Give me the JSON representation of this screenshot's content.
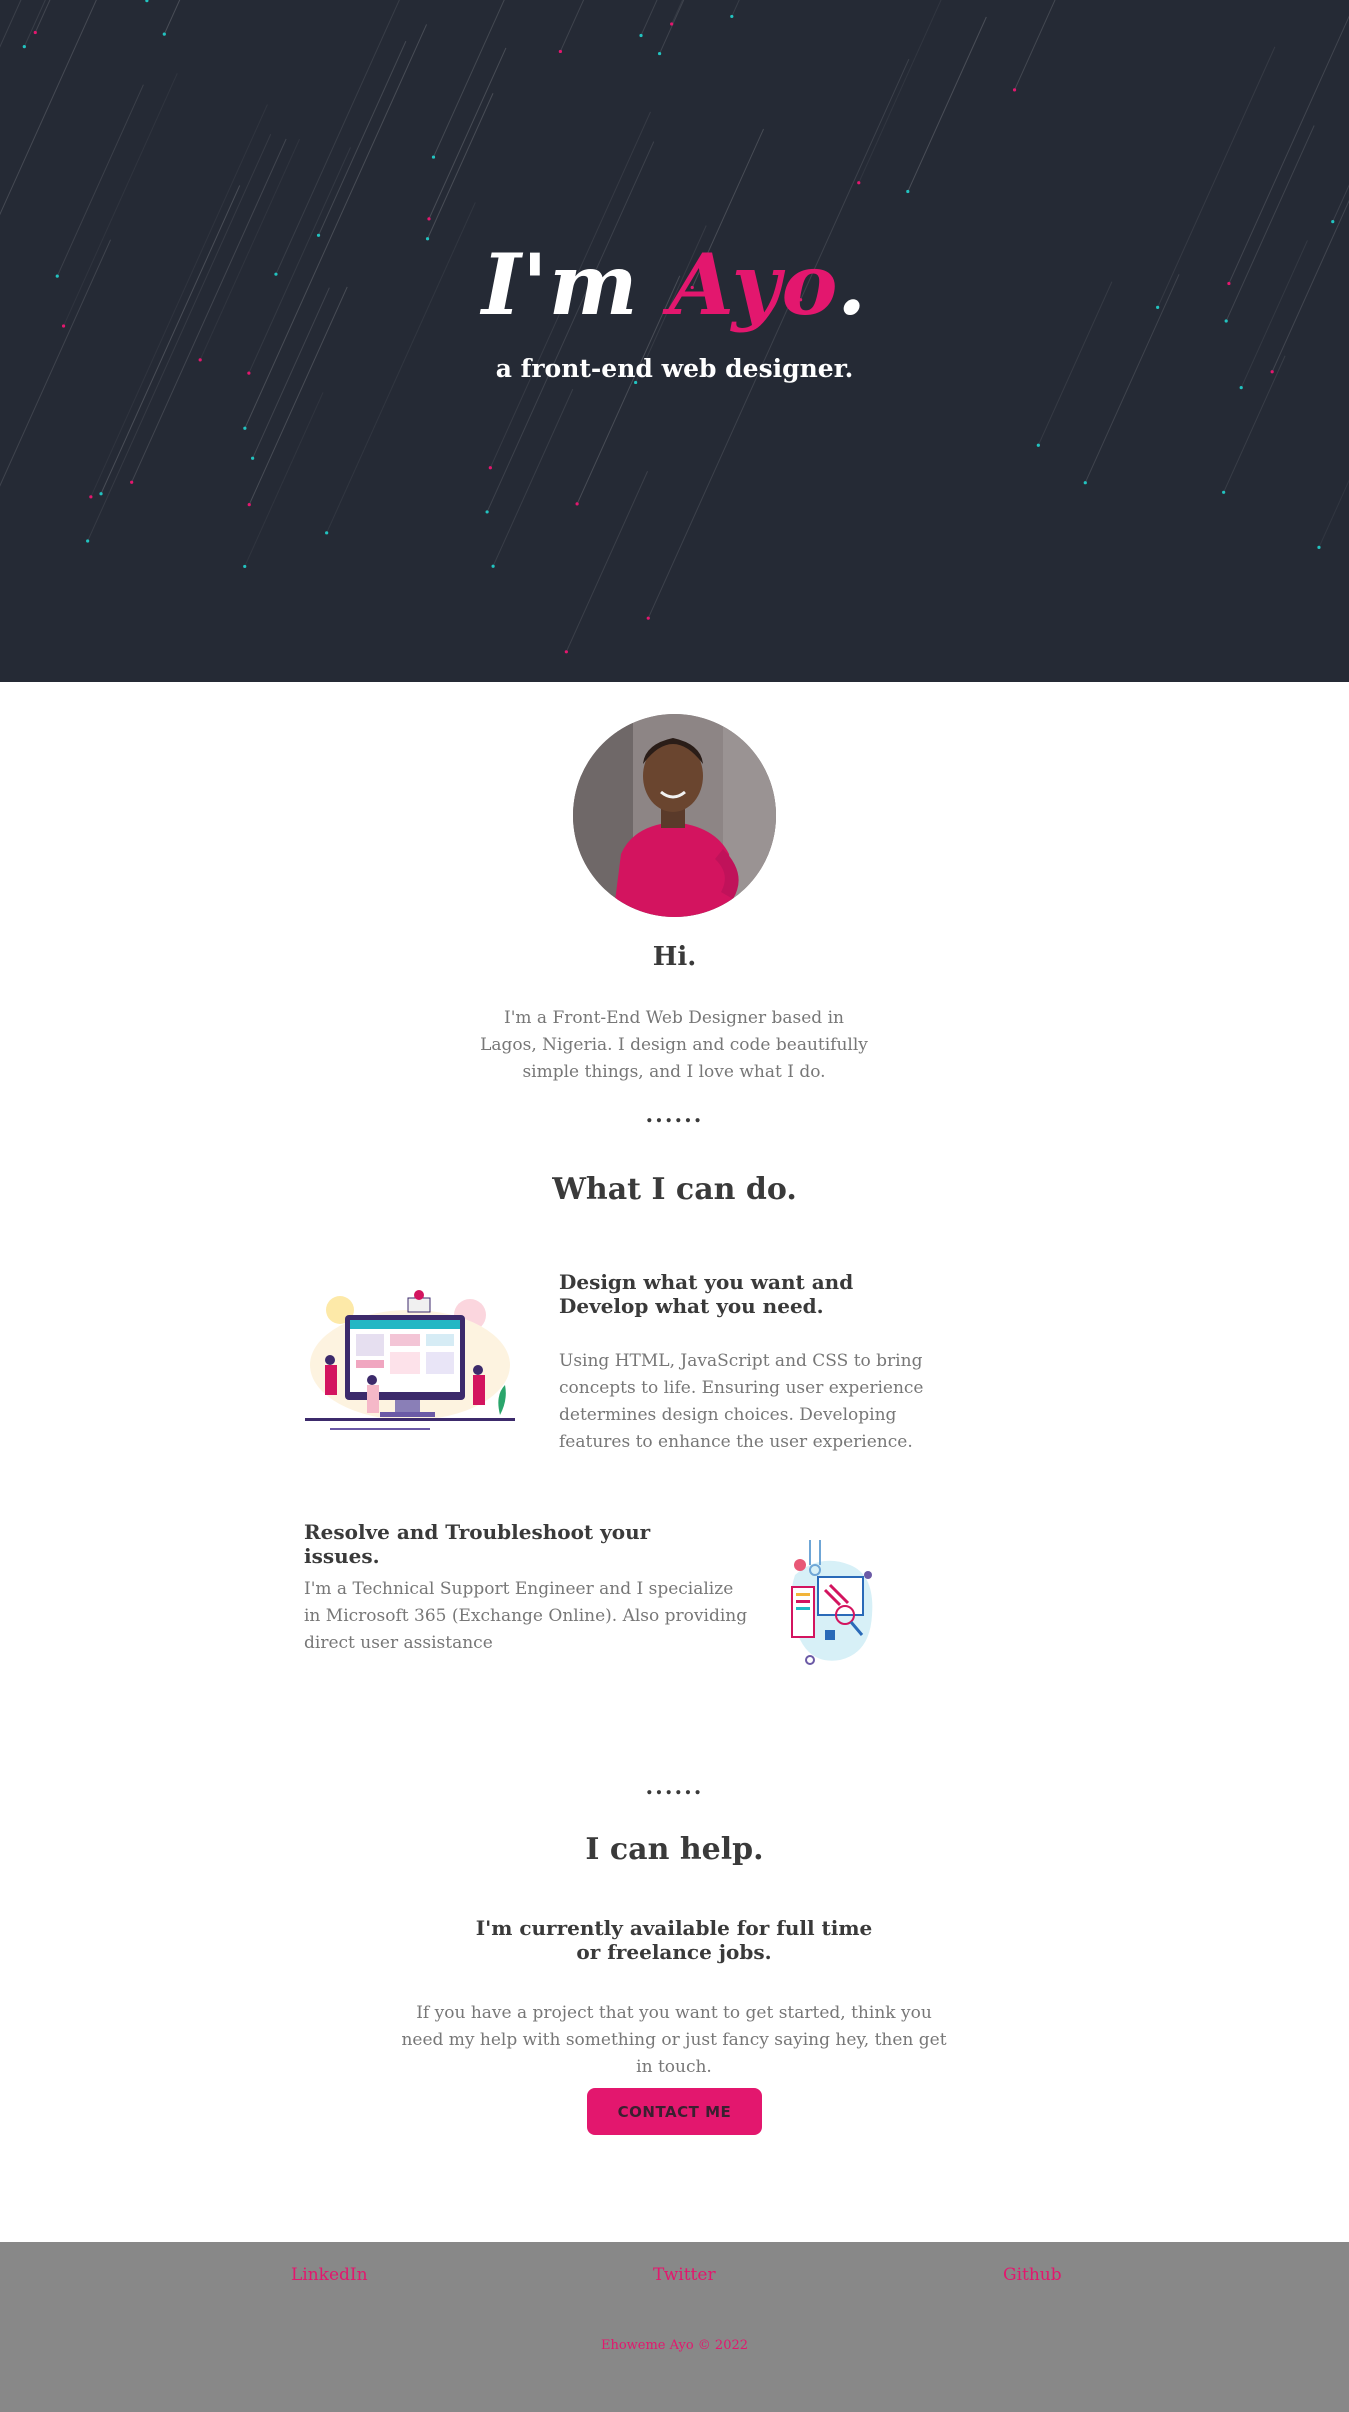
{
  "hero": {
    "greeting": "I'm",
    "name": "Ayo",
    "period": ".",
    "subtitle": "a front-end web designer.",
    "background_color": "#252a35",
    "accent_color": "#e3176e"
  },
  "about": {
    "heading": "Hi.",
    "text": "I'm a Front-End Web Designer based in Lagos, Nigeria. I design and code beautifully simple things, and I love what I do.",
    "divider": "......"
  },
  "skills": {
    "heading": "What I can do.",
    "items": [
      {
        "title": "Design what you want and Develop what you need.",
        "text": "Using HTML, JavaScript and CSS to bring concepts to life. Ensuring user experience determines design choices. Developing features to enhance the user experience.",
        "icon": "web-design-illustration"
      },
      {
        "title": "Resolve and Troubleshoot your issues.",
        "text": "I'm a Technical Support Engineer and I specialize in Microsoft 365 (Exchange Online). Also providing direct user assistance",
        "icon": "tech-support-illustration"
      }
    ]
  },
  "help": {
    "divider": "......",
    "heading": "I can help.",
    "subheading": "I'm currently available for full time or freelance jobs.",
    "text": "If you have a project that you want to get started, think you need my help with something or just fancy saying hey, then get in touch.",
    "button_label": "CONTACT ME"
  },
  "footer": {
    "links": [
      "LinkedIn",
      "Twitter",
      "Github"
    ],
    "copyright": "Ehoweme Ayo © 2022",
    "background_color": "#888888"
  }
}
